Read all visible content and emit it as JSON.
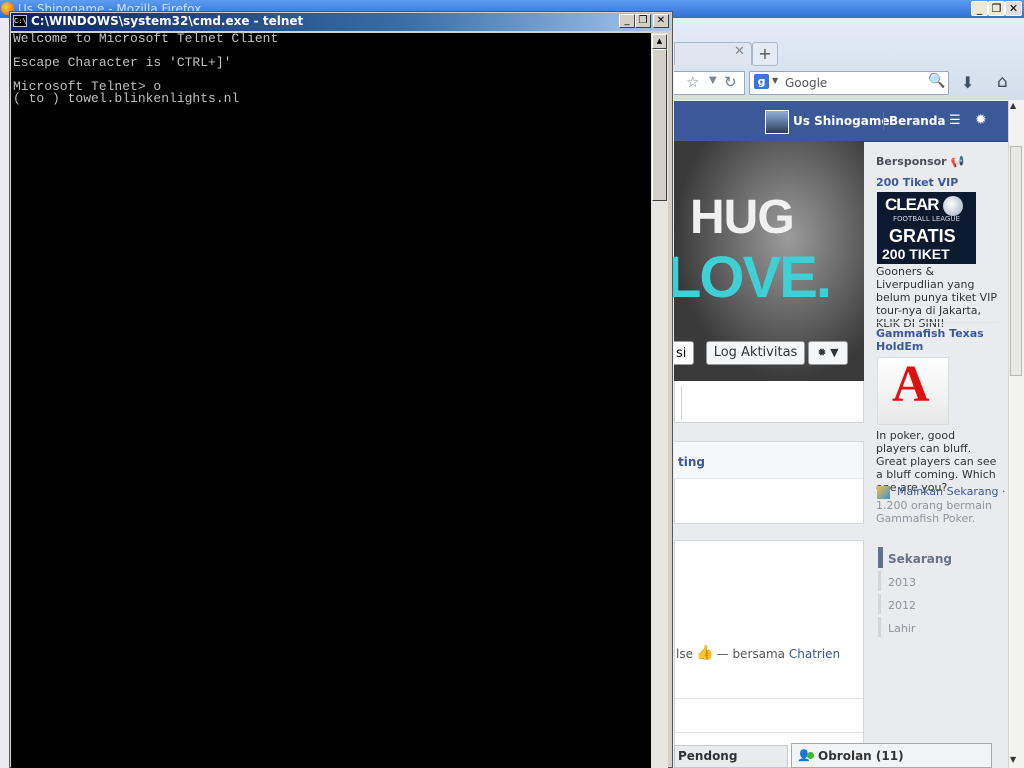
{
  "firefox": {
    "title": "Us Shinogame - Mozilla Firefox",
    "search_placeholder": "Google",
    "window_buttons": {
      "minimize": "_",
      "maximize": "❐",
      "close": "✕"
    }
  },
  "facebook": {
    "topbar": {
      "user_name": "Us Shinogame",
      "home_label": "Beranda"
    },
    "cover": {
      "text_line1": "HUG",
      "text_line2": "LOVE.",
      "partial_button": "si",
      "activity_log_button": "Log Aktivitas"
    },
    "section_label": "ting",
    "post": {
      "prefix": "lse",
      "with_label": "— bersama",
      "friend": "Chatrien"
    },
    "sponsored": {
      "heading": "Bersponsor",
      "ad1": {
        "title": "200 Tiket VIP",
        "image_brand": "CLEAR",
        "image_subtitle": "FOOTBALL LEAGUE",
        "image_line1": "GRATIS",
        "image_line2": "200 TIKET",
        "body": "Gooners & Liverpudlian yang belum punya tiket VIP tour-nya di Jakarta, KLIK DI SINI!"
      },
      "ad2": {
        "title": "Gammafish Texas HoldEm",
        "image_card": "A",
        "body": "In poker, good players can bluff. Great players can see a bluff coming. Which one are you?",
        "play_link": "Mainkan Sekarang ·",
        "players": "1.200 orang bermain Gammafish Poker."
      }
    },
    "timeline": {
      "current": "Sekarang",
      "years": [
        "2013",
        "2012",
        "Lahir"
      ]
    },
    "chat": {
      "pending_label": "Pendong",
      "chat_label": "Obrolan (11)"
    }
  },
  "cmd": {
    "title": "C:\\WINDOWS\\system32\\cmd.exe - telnet",
    "icon_text": "C:\\",
    "output": "Welcome to Microsoft Telnet Client\n\nEscape Character is 'CTRL+]'\n\nMicrosoft Telnet> o\n( to ) towel.blinkenlights.nl"
  },
  "colors": {
    "facebook_blue": "#3b5998",
    "xp_title_blue": "#0a246a",
    "console_text": "#c0c0c0",
    "console_bg": "#000000"
  }
}
